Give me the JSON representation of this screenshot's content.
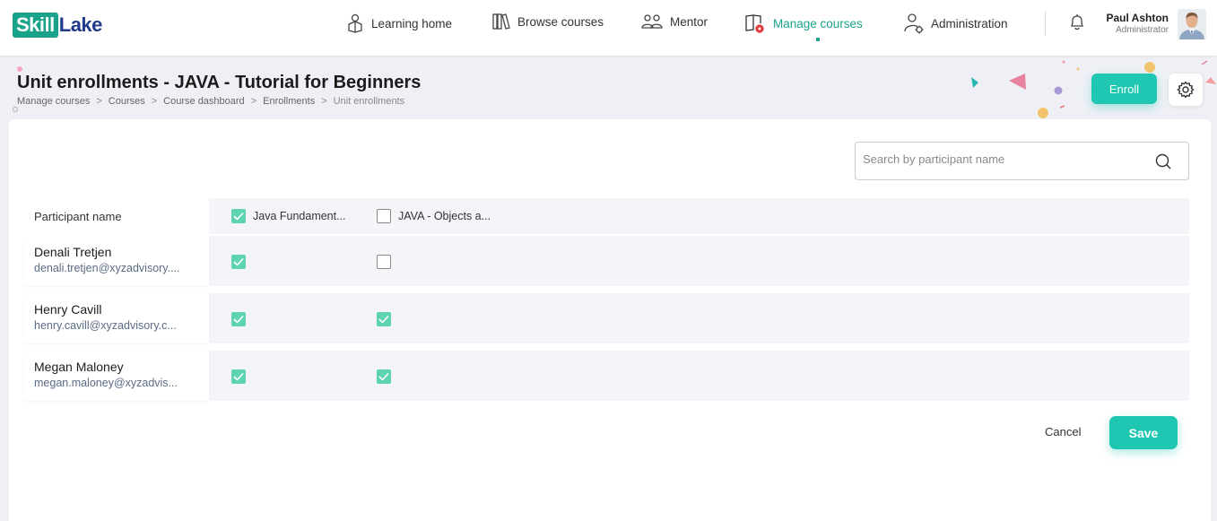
{
  "brand": {
    "part1": "Skill",
    "part2": "Lake"
  },
  "nav": {
    "items": [
      {
        "label": "Learning home",
        "icon": "learning-home-icon"
      },
      {
        "label": "Browse courses",
        "icon": "browse-courses-icon"
      },
      {
        "label": "Mentor",
        "icon": "mentor-icon"
      },
      {
        "label": "Manage courses",
        "icon": "manage-courses-icon",
        "active": true
      },
      {
        "label": "Administration",
        "icon": "administration-icon"
      }
    ]
  },
  "user": {
    "name": "Paul Ashton",
    "role": "Administrator"
  },
  "page": {
    "title": "Unit enrollments - JAVA - Tutorial for Beginners",
    "breadcrumb": [
      "Manage courses",
      "Courses",
      "Course dashboard",
      "Enrollments",
      "Unit enrollments"
    ],
    "enroll_label": "Enroll"
  },
  "search": {
    "placeholder": "Search by participant name",
    "value": ""
  },
  "table": {
    "name_header": "Participant name",
    "columns": [
      {
        "label": "Java Fundament...",
        "checked": true
      },
      {
        "label": "JAVA - Objects a...",
        "checked": false
      }
    ],
    "rows": [
      {
        "name": "Denali Tretjen",
        "email": "denali.tretjen@xyzadvisory....",
        "enrolled": [
          true,
          false
        ]
      },
      {
        "name": "Henry Cavill",
        "email": "henry.cavill@xyzadvisory.c...",
        "enrolled": [
          true,
          true
        ]
      },
      {
        "name": "Megan Maloney",
        "email": "megan.maloney@xyzadvis...",
        "enrolled": [
          true,
          true
        ]
      }
    ]
  },
  "actions": {
    "cancel_label": "Cancel",
    "save_label": "Save"
  },
  "colors": {
    "accent": "#1fc7b3",
    "brand_green": "#1aa38a",
    "brand_blue": "#1f3a8a",
    "check": "#5fd4b3"
  }
}
